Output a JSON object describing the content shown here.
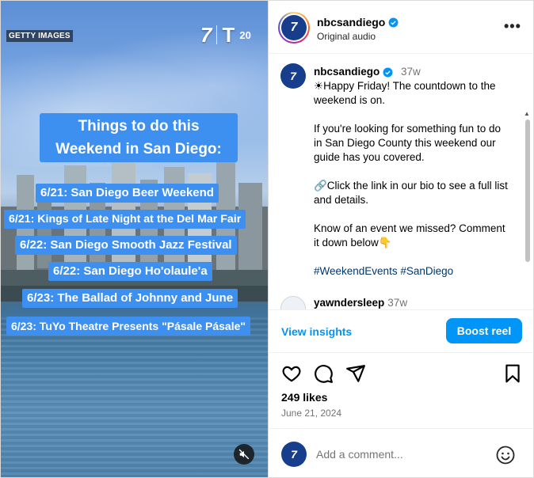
{
  "media": {
    "watermark": "GETTY IMAGES",
    "logo_seven": "7",
    "logo_t": "T",
    "logo_twenty": "20",
    "title": "Things to do this Weekend in San Diego:",
    "events": [
      "6/21: San Diego Beer Weekend",
      "6/21: Kings of Late Night at the Del Mar Fair",
      "6/22: San Diego Smooth Jazz Festival",
      "6/22: San Diego Ho'olaule'a",
      "6/23: The Ballad of Johnny and June",
      "6/23: TuYo Theatre Presents \"Pásale Pásale\""
    ],
    "mute_icon": "speaker-muted-icon"
  },
  "header": {
    "username": "nbcsandiego",
    "audio": "Original audio",
    "more_icon": "more-horizontal-icon"
  },
  "caption": {
    "username": "nbcsandiego",
    "time": "37w",
    "line1": "☀Happy Friday! The countdown to the weekend is on.",
    "line2": "If you're looking for something fun to do in San Diego County this weekend our guide has you covered.",
    "line3": "🔗Click the link in our bio to see a full list and details.",
    "line4": "Know of an event we missed? Comment it down below👇",
    "hashtags": "#WeekendEvents #SanDiego"
  },
  "comment": {
    "username": "yawndersleep",
    "time": "37w"
  },
  "insights": {
    "view_label": "View insights",
    "boost_label": "Boost reel"
  },
  "stats": {
    "likes": "249 likes",
    "date": "June 21, 2024"
  },
  "composer": {
    "placeholder": "Add a comment..."
  },
  "colors": {
    "accent": "#0095f6",
    "event_box": "#3d8ff0",
    "nbc_blue": "#163e8c"
  }
}
